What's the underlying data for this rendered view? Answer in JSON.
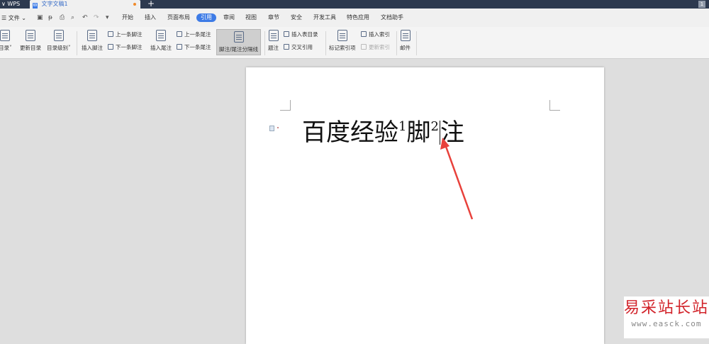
{
  "titlebar": {
    "app_tab": "WPS",
    "doc_tab": "文字文稿1",
    "doc_icon": "W",
    "new_tab": "+",
    "right_badge": "1"
  },
  "menubar": {
    "file_label": "文件",
    "quick_access": [
      "save-icon",
      "format-painter-icon",
      "print-icon",
      "print-preview-icon",
      "undo-icon",
      "redo-icon",
      "customize-icon"
    ],
    "tabs": [
      "开始",
      "插入",
      "页面布局",
      "引用",
      "审阅",
      "视图",
      "章节",
      "安全",
      "开发工具",
      "特色应用",
      "文档助手"
    ],
    "active_tab": "引用"
  },
  "ribbon": {
    "toc": "目录",
    "update_toc": "更新目录",
    "toc_level": "目录级别",
    "insert_footnote": "插入脚注",
    "prev_footnote": "上一条脚注",
    "next_footnote": "下一条脚注",
    "insert_endnote": "插入尾注",
    "prev_endnote": "上一条尾注",
    "next_endnote": "下一条尾注",
    "separator_line": "脚注/尾注分隔线",
    "caption": "题注",
    "insert_table_of_figures": "插入表目录",
    "cross_reference": "交叉引用",
    "mark_index_entry": "标记索引项",
    "insert_index": "插入索引",
    "update_index": "更新索引",
    "mail": "邮件"
  },
  "document": {
    "text_part1": "百度经验",
    "footnote1": "1",
    "text_part2": "脚",
    "footnote2": "2",
    "text_part3": "注"
  },
  "watermark": {
    "title": "易采站长站",
    "url": "www.easck.com"
  },
  "colors": {
    "accent": "#3d7be6",
    "titlebar": "#2d3a4f",
    "arrow": "#e8413b",
    "watermark": "#d2232a"
  }
}
